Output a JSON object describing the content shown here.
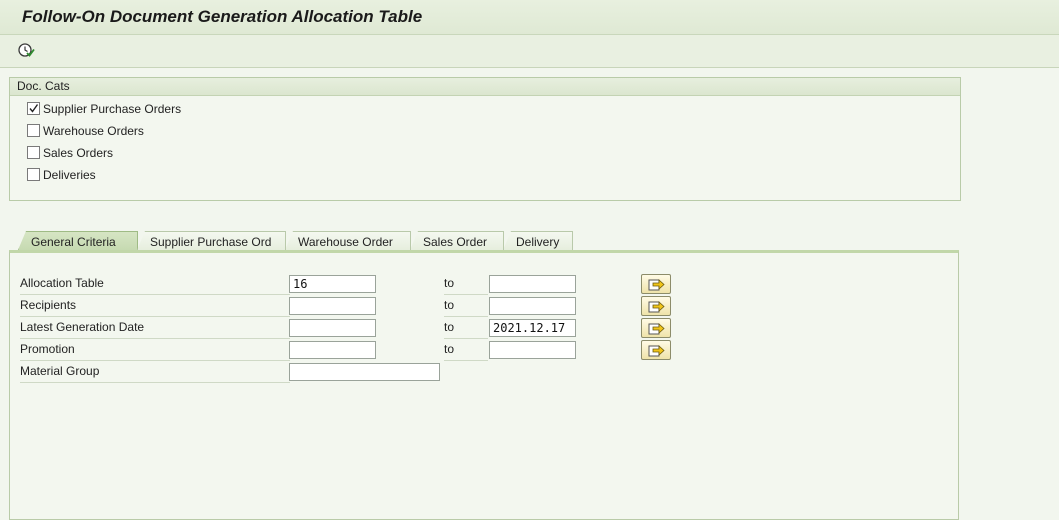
{
  "header": {
    "title": "Follow-On Document Generation Allocation Table"
  },
  "toolbar": {
    "execute_icon": "execute-clock-icon"
  },
  "doc_cats": {
    "title": "Doc. Cats",
    "items": [
      {
        "label": "Supplier Purchase Orders",
        "checked": true
      },
      {
        "label": "Warehouse Orders",
        "checked": false
      },
      {
        "label": "Sales Orders",
        "checked": false
      },
      {
        "label": "Deliveries",
        "checked": false
      }
    ]
  },
  "tabs": [
    {
      "label": "General Criteria",
      "active": true
    },
    {
      "label": "Supplier Purchase Ord",
      "active": false
    },
    {
      "label": "Warehouse Order",
      "active": false
    },
    {
      "label": "Sales Order",
      "active": false
    },
    {
      "label": "Delivery",
      "active": false
    }
  ],
  "criteria": {
    "to_label": "to",
    "rows": [
      {
        "label": "Allocation Table",
        "from": "16",
        "to": ""
      },
      {
        "label": "Recipients",
        "from": "",
        "to": ""
      },
      {
        "label": "Latest Generation Date",
        "from": "",
        "to": "2021.12.17"
      },
      {
        "label": "Promotion",
        "from": "",
        "to": ""
      },
      {
        "label": "Material Group",
        "from": ""
      }
    ]
  }
}
